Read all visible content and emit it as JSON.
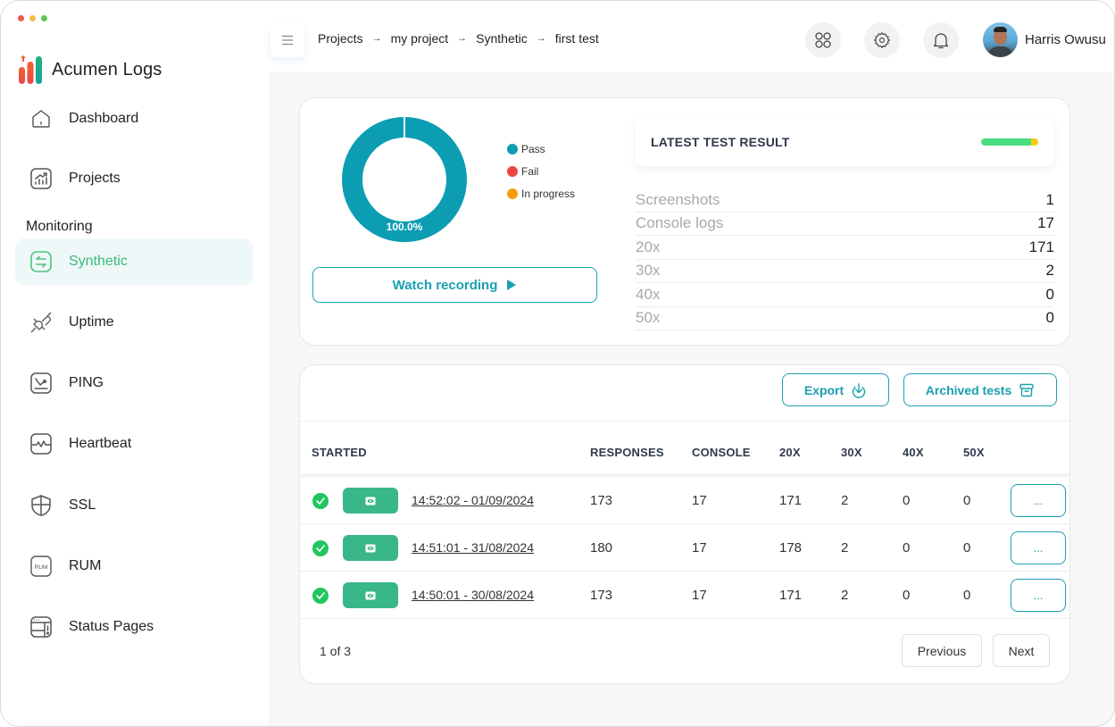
{
  "window": {
    "traffic_colors": [
      "#ee5a52",
      "#f5bd4f",
      "#5fc454"
    ]
  },
  "brand": {
    "name": "Acumen Logs"
  },
  "sidebar": {
    "section_label": "Monitoring",
    "items": [
      {
        "label": "Dashboard",
        "icon": "home-icon",
        "active": false
      },
      {
        "label": "Projects",
        "icon": "chart-up-icon",
        "active": false
      },
      {
        "label": "Synthetic",
        "icon": "swap-arrows-icon",
        "active": true
      },
      {
        "label": "Uptime",
        "icon": "plug-icon",
        "active": false
      },
      {
        "label": "PING",
        "icon": "ping-gauge-icon",
        "active": false
      },
      {
        "label": "Heartbeat",
        "icon": "pulse-icon",
        "active": false
      },
      {
        "label": "SSL",
        "icon": "shield-icon",
        "active": false
      },
      {
        "label": "RUM",
        "icon": "rum-badge-icon",
        "active": false
      },
      {
        "label": "Status Pages",
        "icon": "status-page-icon",
        "active": false
      }
    ]
  },
  "header": {
    "breadcrumb": [
      "Projects",
      "my project",
      "Synthetic",
      "first test"
    ],
    "breadcrumb_separator": "→",
    "icons": [
      "apps-grid-icon",
      "gear-icon",
      "bell-icon"
    ],
    "user_name": "Harris Owusu"
  },
  "summary": {
    "chart_data": {
      "type": "pie",
      "style": "donut",
      "categories": [
        "Pass",
        "Fail",
        "In progress"
      ],
      "values": [
        100.0,
        0.0,
        0.0
      ],
      "colors": [
        "#0c9db2",
        "#ef4444",
        "#f59e0b"
      ],
      "data_label": "100.0%",
      "legend_position": "right"
    },
    "watch_button": "Watch recording",
    "latest": {
      "title": "LATEST TEST RESULT",
      "bar_segments": [
        {
          "label": "success",
          "fraction": 0.87,
          "color": "#4ade80"
        },
        {
          "label": "warning",
          "fraction": 0.13,
          "color": "#facc15"
        }
      ]
    },
    "stats": [
      {
        "label": "Screenshots",
        "value": "1"
      },
      {
        "label": "Console logs",
        "value": "17"
      },
      {
        "label": "20x",
        "value": "171"
      },
      {
        "label": "30x",
        "value": "2"
      },
      {
        "label": "40x",
        "value": "0"
      },
      {
        "label": "50x",
        "value": "0"
      }
    ]
  },
  "table": {
    "toolbar": {
      "export_label": "Export",
      "archived_label": "Archived tests"
    },
    "columns": [
      "STARTED",
      "RESPONSES",
      "CONSOLE",
      "20X",
      "30X",
      "40X",
      "50X"
    ],
    "rows": [
      {
        "status": "passed",
        "started": "14:52:02 - 01/09/2024",
        "responses": "173",
        "console": "17",
        "c20x": "171",
        "c30x": "2",
        "c40x": "0",
        "c50x": "0",
        "action": "..."
      },
      {
        "status": "passed",
        "started": "14:51:01 - 31/08/2024",
        "responses": "180",
        "console": "17",
        "c20x": "178",
        "c30x": "2",
        "c40x": "0",
        "c50x": "0",
        "action": "..."
      },
      {
        "status": "passed",
        "started": "14:50:01 - 30/08/2024",
        "responses": "173",
        "console": "17",
        "c20x": "171",
        "c30x": "2",
        "c40x": "0",
        "c50x": "0",
        "action": "..."
      }
    ],
    "pagination": {
      "info": "1 of 3",
      "previous": "Previous",
      "next": "Next"
    }
  },
  "colors": {
    "accent": "#1a9fb0",
    "active_nav": "#3bb874",
    "success": "#22c55e",
    "recording_badge": "#3ab789"
  }
}
